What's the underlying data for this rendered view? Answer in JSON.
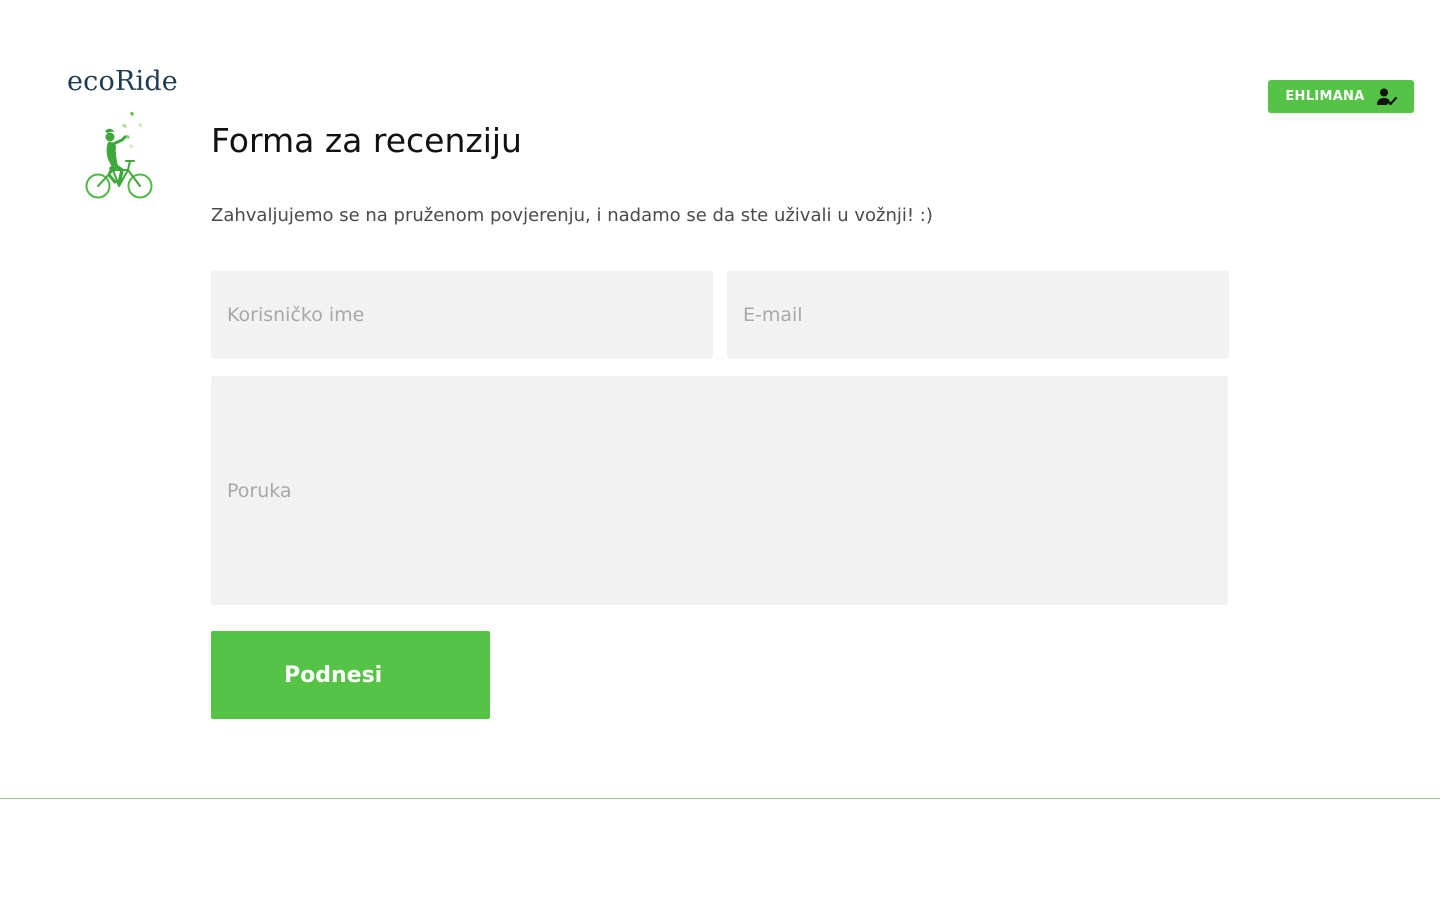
{
  "brand": {
    "name": "ecoRide",
    "logo_icon": "cyclist-logo-icon",
    "text_color": "#1f3b52",
    "accent_color": "#3fa83a"
  },
  "header": {
    "user_button_label": "EHLIMANA",
    "user_icon": "user-check-icon",
    "button_color": "#54c346"
  },
  "main": {
    "title": "Forma za recenziju",
    "subtitle": "Zahvaljujemo se na pruženom povjerenju, i nadamo se da ste uživali u vožnji! :)",
    "form": {
      "username": {
        "placeholder": "Korisničko ime",
        "value": ""
      },
      "email": {
        "placeholder": "E-mail",
        "value": ""
      },
      "message": {
        "placeholder": "Poruka",
        "value": ""
      },
      "submit_label": "Podnesi"
    }
  },
  "colors": {
    "field_background": "#f2f2f2",
    "placeholder_text": "#a8a8a8",
    "footer_line": "#8fd28a"
  }
}
